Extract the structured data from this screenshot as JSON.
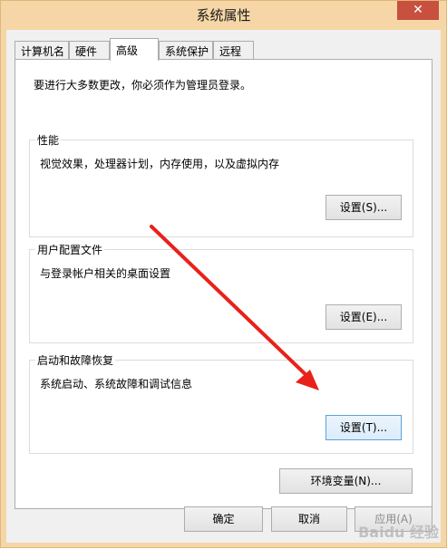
{
  "window": {
    "title": "系统属性",
    "close_glyph": "✕"
  },
  "tabs": [
    {
      "label": "计算机名",
      "active": false
    },
    {
      "label": "硬件",
      "active": false
    },
    {
      "label": "高级",
      "active": true
    },
    {
      "label": "系统保护",
      "active": false
    },
    {
      "label": "远程",
      "active": false
    }
  ],
  "advanced": {
    "admin_note": "要进行大多数更改，你必须作为管理员登录。",
    "performance": {
      "title": "性能",
      "description": "视觉效果，处理器计划，内存使用，以及虚拟内存",
      "button": "设置(S)..."
    },
    "user_profiles": {
      "title": "用户配置文件",
      "description": "与登录帐户相关的桌面设置",
      "button": "设置(E)..."
    },
    "startup_recovery": {
      "title": "启动和故障恢复",
      "description": "系统启动、系统故障和调试信息",
      "button": "设置(T)..."
    },
    "env_button": "环境变量(N)..."
  },
  "footer": {
    "ok": "确定",
    "cancel": "取消",
    "apply": "应用(A)"
  },
  "annotation": {
    "arrow_color": "#e8211a"
  },
  "watermark": "Baidu 经验",
  "colors": {
    "titlebar": "#f6d6a6",
    "close_button": "#c7503f",
    "focus_border": "#5aa2dc"
  }
}
